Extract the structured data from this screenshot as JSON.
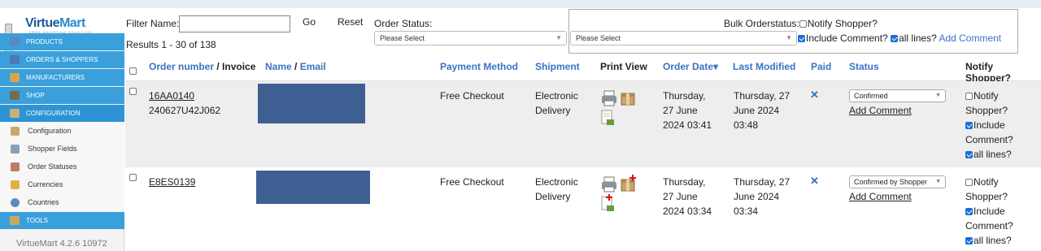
{
  "sidebar": {
    "logo": {
      "prefix": "Virtue",
      "suffix": "Mart",
      "tagline": "FREE SHOPPING SOLUTION"
    },
    "collapse_glyph": "◀",
    "menu": [
      {
        "label": "PRODUCTS",
        "icon": "products-icon",
        "color": "#5b88c0"
      },
      {
        "label": "ORDERS & SHOPPERS",
        "icon": "orders-icon",
        "color": "#4a7ab5"
      },
      {
        "label": "MANUFACTURERS",
        "icon": "wrench-icon",
        "color": "#d6a64a"
      },
      {
        "label": "SHOP",
        "icon": "shop-icon",
        "color": "#7a6a55"
      },
      {
        "label": "CONFIGURATION",
        "icon": "tools-icon",
        "color": "#c9b27a"
      }
    ],
    "submenu": [
      {
        "label": "Configuration",
        "icon": "configuration-icon",
        "color": "#c8a86a"
      },
      {
        "label": "Shopper Fields",
        "icon": "shopper-fields-icon",
        "color": "#8aa0b8"
      },
      {
        "label": "Order Statuses",
        "icon": "order-statuses-icon",
        "color": "#c07a6a"
      },
      {
        "label": "Currencies",
        "icon": "currencies-icon",
        "color": "#e0b040"
      },
      {
        "label": "Countries",
        "icon": "globe-icon",
        "color": "#5a8ac0"
      }
    ],
    "tools": {
      "label": "TOOLS",
      "icon": "tools-menu-icon",
      "color": "#c9a85a"
    },
    "version": "VirtueMart 4.2.6 10972"
  },
  "toolbar": {
    "filter_label": "Filter Name:",
    "filter_value": "",
    "go_label": "Go",
    "reset_label": "Reset",
    "results": "Results 1 - 30 of 138",
    "order_status_label": "Order Status:",
    "order_status_value": "Please Select",
    "bulk_label": "Bulk Orderstatus:",
    "bulk_value": "Please Select",
    "notify_label": "Notify Shopper?",
    "include_comment_label": "Include Comment?",
    "all_lines_label": "all lines?",
    "add_comment_label": "Add Comment"
  },
  "table": {
    "headers": {
      "order_number": "Order number",
      "slash1": " / ",
      "invoice": "Invoice",
      "name": "Name",
      "slash2": " / ",
      "email": "Email",
      "payment": "Payment Method",
      "shipment": "Shipment",
      "print_view": "Print View",
      "order_date": "Order Date",
      "sort_arrow": "▾",
      "last_modified": "Last Modified",
      "paid": "Paid",
      "status": "Status",
      "notify": "Notify Shopper?"
    },
    "rows": [
      {
        "order_number": "16AA0140",
        "invoice": "240627U42J062",
        "payment": "Free Checkout",
        "shipment_line1": "Electronic",
        "shipment_line2": "Delivery",
        "date_line1": "Thursday,",
        "date_line2": "27 June",
        "date_line3": "2024 03:41",
        "mod_line1": "Thursday, 27",
        "mod_line2": "June 2024",
        "mod_line3": "03:48",
        "paid": "✕",
        "status": "Confirmed",
        "add_comment": "Add Comment",
        "notify_l1": "Notify",
        "notify_l2": "Shopper?",
        "include_l1": "Include",
        "include_l2": "Comment?",
        "all_lines": "all lines?",
        "background": "#eeeeee"
      },
      {
        "order_number": "E8ES0139",
        "invoice": "",
        "payment": "Free Checkout",
        "shipment_line1": "Electronic",
        "shipment_line2": "Delivery",
        "date_line1": "Thursday,",
        "date_line2": "27 June",
        "date_line3": "2024 03:34",
        "mod_line1": "Thursday, 27",
        "mod_line2": "June 2024",
        "mod_line3": "03:34",
        "paid": "✕",
        "status": "Confirmed by Shopper",
        "add_comment": "Add Comment",
        "notify_l1": "Notify",
        "notify_l2": "Shopper?",
        "include_l1": "Include",
        "include_l2": "Comment?",
        "all_lines": "all lines?",
        "background": "#ffffff"
      }
    ]
  },
  "colors": {
    "accent": "#3aa0db",
    "link": "#3b73c4",
    "redaction": "#3e5f92"
  }
}
